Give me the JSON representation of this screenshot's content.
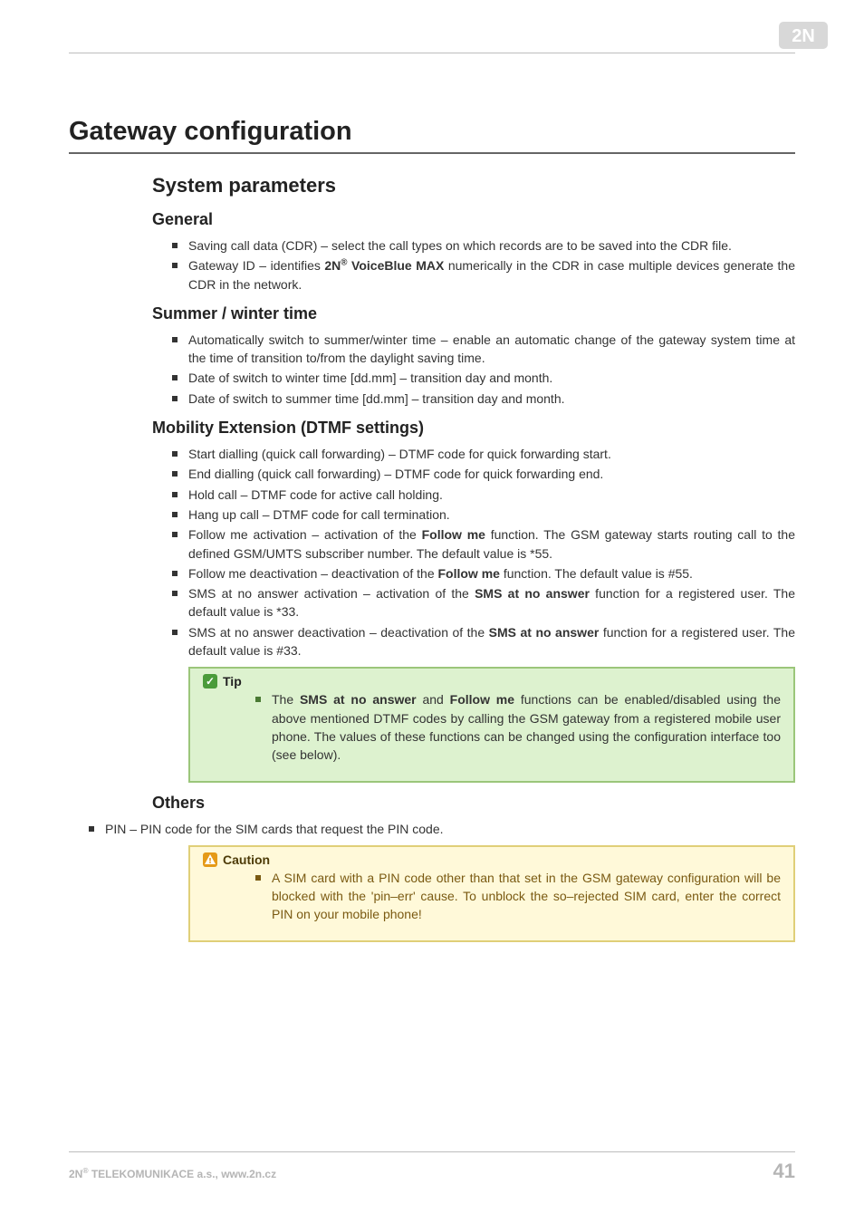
{
  "h1": "Gateway configuration",
  "h2": "System parameters",
  "sections": {
    "general": {
      "title": "General",
      "items": [
        "Saving call data (CDR) – select the call types on which records are to be saved into the CDR file.",
        "Gateway ID – identifies <b>2N<sup>®</sup> VoiceBlue MAX</b> numerically in the CDR in case multiple devices generate the CDR in the network."
      ]
    },
    "summer": {
      "title": "Summer / winter time",
      "items": [
        "Automatically switch to summer/winter time – enable an automatic change of the gateway system time at the time of transition to/from the daylight saving time.",
        "Date of switch to winter time [dd.mm] – transition day and month.",
        "Date of switch to summer time [dd.mm] – transition day and month."
      ]
    },
    "mobility": {
      "title": "Mobility Extension (DTMF settings)",
      "items": [
        "Start dialling (quick call forwarding) – DTMF code for quick forwarding start.",
        "End dialling (quick call forwarding) – DTMF code for quick forwarding end.",
        "Hold call – DTMF code for active call holding.",
        "Hang up call – DTMF code for call termination.",
        "Follow me activation – activation of the <b>Follow me</b> function. The GSM gateway starts routing call to the defined GSM/UMTS subscriber number. The default value is *55.",
        "Follow me deactivation – deactivation of the <b>Follow me</b> function. The default value is #55.",
        "SMS at no answer activation – activation of the <b>SMS at no answer</b> function for a registered user. The default value is *33.",
        "SMS at no answer deactivation – deactivation of the <b>SMS at no answer</b> function for a registered user. The default value is #33."
      ]
    },
    "others": {
      "title": "Others",
      "pin_item": "PIN – PIN code for the SIM cards that request the PIN code."
    }
  },
  "tip": {
    "title": "Tip",
    "text": "The <b>SMS at no answer</b> and <b>Follow me</b> functions can be enabled/disabled using the above mentioned DTMF codes by calling the GSM gateway from a registered mobile user phone. The values of these functions can be changed using the configuration interface too (see below)."
  },
  "caution": {
    "title": "Caution",
    "text": "A SIM card with a PIN code other than that set in the GSM gateway configuration will be blocked with the 'pin–err' cause. To unblock the so–rejected SIM card, enter the correct PIN on your mobile phone!"
  },
  "footer": {
    "left": "2N<sup>®</sup> TELEKOMUNIKACE a.s., www.2n.cz",
    "right": "41"
  }
}
